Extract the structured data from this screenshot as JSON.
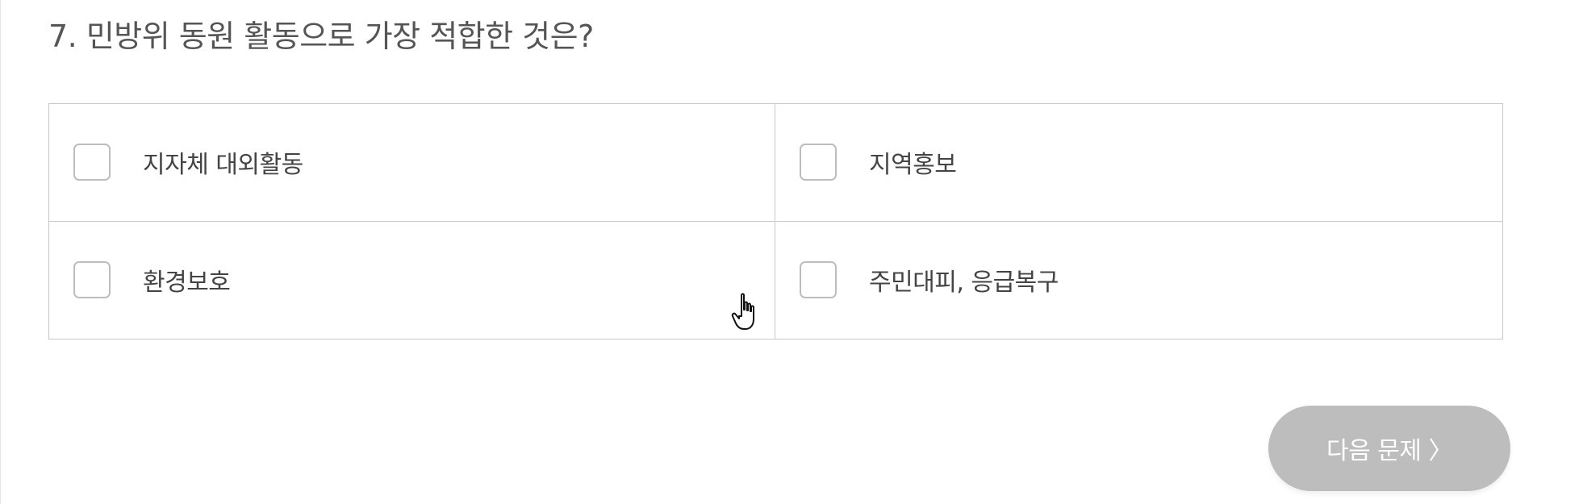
{
  "question": {
    "title": "7. 민방위 동원 활동으로 가장 적합한 것은?"
  },
  "options": [
    {
      "label": "지자체 대외활동",
      "checked": false
    },
    {
      "label": "지역홍보",
      "checked": false
    },
    {
      "label": "환경보호",
      "checked": false
    },
    {
      "label": "주민대피, 응급복구",
      "checked": false
    }
  ],
  "next_button": {
    "label": "다음 문제 〉"
  },
  "colors": {
    "title_text": "#555555",
    "option_text": "#444444",
    "border": "#c9c9c9",
    "checkbox_border": "#bdbdbd",
    "button_bg": "#bdbdbd",
    "button_text": "#ffffff"
  },
  "cursor": {
    "icon": "hand-pointer-icon"
  }
}
